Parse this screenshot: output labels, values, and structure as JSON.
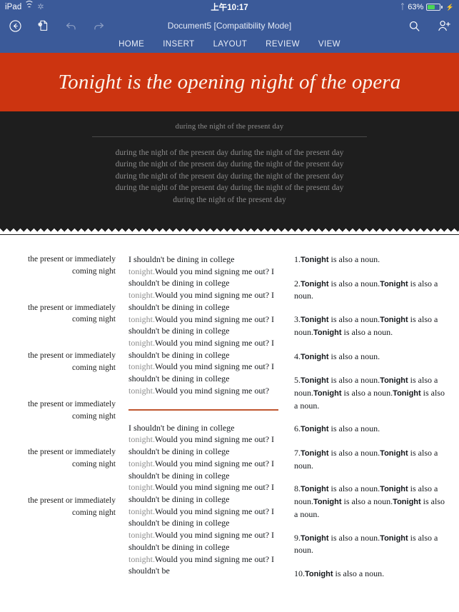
{
  "status_bar": {
    "device": "iPad",
    "wifi_icon": "wifi-icon",
    "sync_icon": "sync-spinner-icon",
    "time": "上午10:17",
    "bluetooth_icon": "bluetooth-icon",
    "battery_percent": "63%",
    "battery_level": 63,
    "charging_icon": "lightning-bolt-icon",
    "bg_color": "#3B5A99"
  },
  "toolbar": {
    "back_label": "back-arrow",
    "file_label": "file-document",
    "undo_label": "undo",
    "redo_label": "redo",
    "search_label": "search",
    "share_label": "add-person",
    "document_title": "Document5 [Compatibility Mode]"
  },
  "ribbon": {
    "tabs": [
      {
        "label": "HOME"
      },
      {
        "label": "INSERT"
      },
      {
        "label": "LAYOUT"
      },
      {
        "label": "REVIEW"
      },
      {
        "label": "VIEW"
      }
    ]
  },
  "document": {
    "banner": {
      "title": "Tonight is the opening night of the opera",
      "bg_color": "#CC3410",
      "text_color": "#FBF4EC"
    },
    "dark_block": {
      "bg_color": "#1E1E1E",
      "subtitle": "during the night of the present day",
      "body": "during the night of the present day during the night of the present day during the night of the present day during the night of the present day during the night of the present day during the night of the present day during the night of the present day during the night of the present day during the night of the present day"
    },
    "columns": {
      "left": {
        "block_text": "the present or immediately coming night",
        "block_count": 6
      },
      "middle": {
        "rule_color": "#C0562F",
        "paragraph_1_parts": [
          {
            "t": "I shouldn't be dining in college ",
            "s": "normal"
          },
          {
            "t": "tonight.",
            "s": "light"
          },
          {
            "t": "Would you mind signing me out? I shouldn't be dining in college ",
            "s": "normal"
          },
          {
            "t": "tonight.",
            "s": "light"
          },
          {
            "t": "Would you mind signing me out? I shouldn't be dining in college ",
            "s": "normal"
          },
          {
            "t": "tonight.",
            "s": "light"
          },
          {
            "t": "Would you mind signing me out? I shouldn't be dining in college ",
            "s": "normal"
          },
          {
            "t": "tonight.",
            "s": "light"
          },
          {
            "t": "Would you mind signing me out? I shouldn't be dining in college ",
            "s": "normal"
          },
          {
            "t": "tonight.",
            "s": "light"
          },
          {
            "t": "Would you mind signing me out? I shouldn't be dining in college ",
            "s": "normal"
          },
          {
            "t": "tonight.",
            "s": "light"
          },
          {
            "t": "Would you mind signing me out?",
            "s": "normal"
          }
        ],
        "paragraph_2_parts": [
          {
            "t": "I shouldn't be dining in college ",
            "s": "normal"
          },
          {
            "t": "tonight.",
            "s": "light"
          },
          {
            "t": "Would you mind signing me out? I shouldn't be dining in college ",
            "s": "normal"
          },
          {
            "t": "tonight.",
            "s": "light"
          },
          {
            "t": "Would you mind signing me out? I shouldn't be dining in college ",
            "s": "normal"
          },
          {
            "t": "tonight.",
            "s": "light"
          },
          {
            "t": "Would you mind signing me out? I shouldn't be dining in college ",
            "s": "normal"
          },
          {
            "t": "tonight.",
            "s": "light"
          },
          {
            "t": "Would you mind signing me out? I shouldn't be dining in college ",
            "s": "normal"
          },
          {
            "t": "tonight.",
            "s": "light"
          },
          {
            "t": "Would you mind signing me out? I shouldn't be dining in college ",
            "s": "normal"
          },
          {
            "t": "tonight.",
            "s": "light"
          },
          {
            "t": "Would you mind signing me out? I shouldn't be",
            "s": "normal"
          }
        ]
      },
      "right": {
        "items": [
          {
            "num": "1.",
            "repeat": 1
          },
          {
            "num": "2.",
            "repeat": 2
          },
          {
            "num": "3.",
            "repeat": 3
          },
          {
            "num": "4.",
            "repeat": 1
          },
          {
            "num": "5.",
            "repeat": 4
          },
          {
            "num": "6.",
            "repeat": 1
          },
          {
            "num": "7.",
            "repeat": 2
          },
          {
            "num": "8.",
            "repeat": 4
          },
          {
            "num": "9.",
            "repeat": 2
          },
          {
            "num": "10.",
            "repeat": 1
          }
        ],
        "bold_word": "Tonight",
        "rest_text": " is also a noun."
      }
    }
  }
}
